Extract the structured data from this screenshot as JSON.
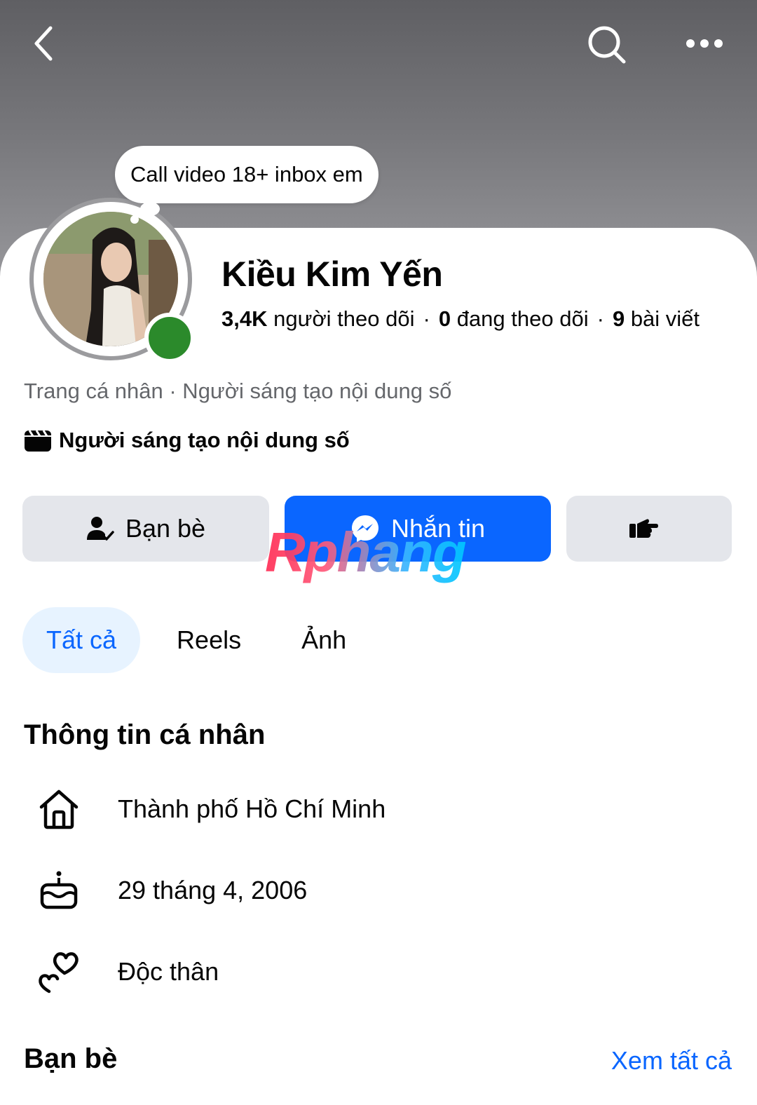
{
  "nav": {
    "back_icon": "chevron-left-icon",
    "search_icon": "search-icon",
    "more_icon": "more-horizontal-icon"
  },
  "note": {
    "text": "Call video 18+ inbox em"
  },
  "profile": {
    "name": "Kiều Kim Yến",
    "followers_count": "3,4K",
    "followers_label": "người theo dõi",
    "following_count": "0",
    "following_label": "đang theo dõi",
    "posts_count": "9",
    "posts_label": "bài viết",
    "subtitle": "Trang cá nhân · Người sáng tạo nội dung số",
    "category": "Người sáng tạo nội dung số",
    "online_color": "#2b8a2b"
  },
  "actions": {
    "friends_label": "Bạn bè",
    "message_label": "Nhắn tin",
    "poke_icon": "poke-hand-icon"
  },
  "watermark": "Rphang",
  "tabs": [
    {
      "label": "Tất cả",
      "active": true
    },
    {
      "label": "Reels",
      "active": false
    },
    {
      "label": "Ảnh",
      "active": false
    }
  ],
  "personal_info": {
    "title": "Thông tin cá nhân",
    "items": [
      {
        "icon": "home-icon",
        "text": "Thành phố Hồ Chí Minh"
      },
      {
        "icon": "birthday-cake-icon",
        "text": "29 tháng 4, 2006"
      },
      {
        "icon": "hearts-icon",
        "text": "Độc thân"
      }
    ]
  },
  "friends": {
    "title": "Bạn bè",
    "see_all": "Xem tất cả"
  },
  "colors": {
    "accent": "#0a66ff",
    "button_gray": "#e4e6eb",
    "tab_active_bg": "#e7f3ff"
  }
}
